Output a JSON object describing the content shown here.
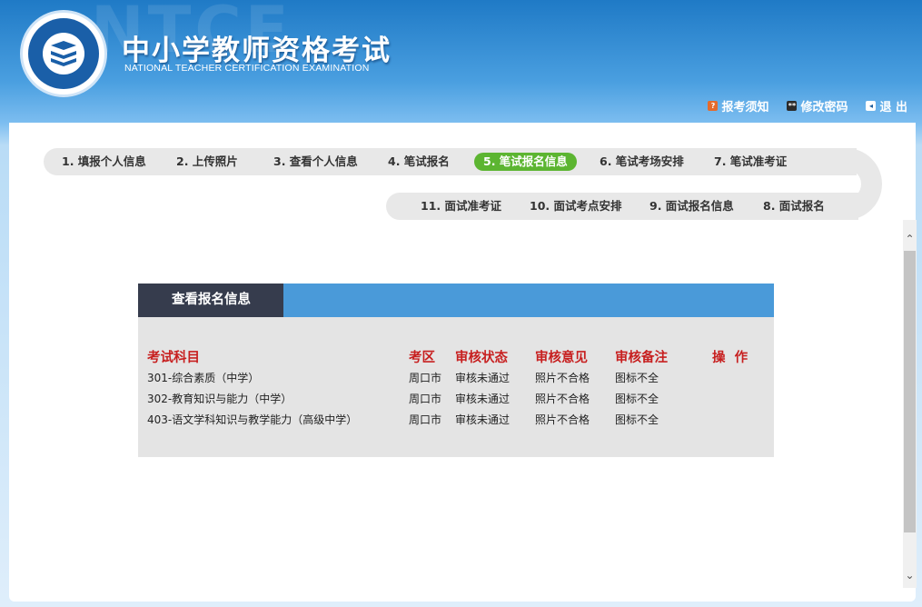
{
  "header": {
    "watermark": "NTCE",
    "title": "中小学教师资格考试",
    "subtitle": "NATIONAL TEACHER CERTIFICATION EXAMINATION",
    "links": [
      {
        "label": "报考须知",
        "icon": "help-icon"
      },
      {
        "label": "修改密码",
        "icon": "password-icon"
      },
      {
        "label": "退 出",
        "icon": "exit-icon"
      }
    ]
  },
  "steps": {
    "row1": [
      "1. 填报个人信息",
      "2. 上传照片",
      "3. 查看个人信息",
      "4. 笔试报名",
      "5. 笔试报名信息",
      "6. 笔试考场安排",
      "7. 笔试准考证"
    ],
    "row2": [
      "11. 面试准考证",
      "10. 面试考点安排",
      "9. 面试报名信息",
      "8. 面试报名"
    ],
    "active": "5. 笔试报名信息"
  },
  "info": {
    "title": "查看报名信息",
    "columns": [
      "考试科目",
      "考区",
      "审核状态",
      "审核意见",
      "审核备注",
      "操  作"
    ],
    "rows": [
      [
        "301-综合素质（中学）",
        "周口市",
        "审核未通过",
        "照片不合格",
        "图标不全",
        ""
      ],
      [
        "302-教育知识与能力（中学）",
        "周口市",
        "审核未通过",
        "照片不合格",
        "图标不全",
        ""
      ],
      [
        "403-语文学科知识与教学能力（高级中学）",
        "周口市",
        "审核未通过",
        "照片不合格",
        "图标不全",
        ""
      ]
    ]
  },
  "colors": {
    "header_blue": "#1f7ac6",
    "tab_dark": "#363c4d",
    "bar_blue": "#4a9ad9",
    "active_green": "#5cb531",
    "header_red": "#c71f1f"
  }
}
